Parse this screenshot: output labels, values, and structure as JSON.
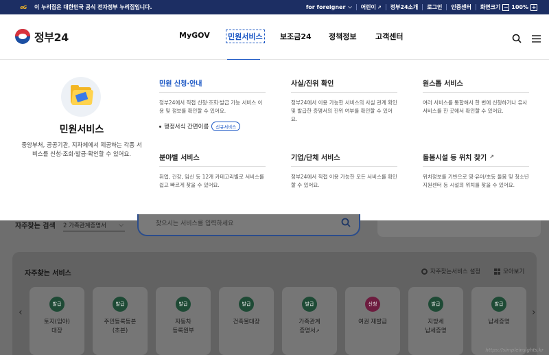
{
  "gov_bar": {
    "logo": "eG",
    "notice": "이 누리집은 대한민국 공식 전자정부 누리집입니다.",
    "links": [
      "for foreigner",
      "어린이",
      "정부24소개",
      "로그인",
      "인증센터",
      "화면크기"
    ],
    "zoom_minus": "−",
    "zoom_value": "100%",
    "zoom_plus": "+"
  },
  "header": {
    "logo_text": "정부24",
    "nav": [
      "MyGOV",
      "민원서비스",
      "보조금24",
      "정책정보",
      "고객센터"
    ]
  },
  "mega_menu": {
    "intro_title": "민원서비스",
    "intro_desc": "중앙부처, 공공기관, 지자체에서 제공하는 각종 서비스를 신청·조회·발급·확인할 수 있어요.",
    "sections": [
      {
        "title": "민원 신청·안내",
        "desc": "정부24에서 직접 신청·조회·발급 가능 서비스 이용 및 정보를 확인할 수 있어요.",
        "sub_item": "행정서식 간편이름",
        "sub_badge": "신규서비스"
      },
      {
        "title": "사실/진위 확인",
        "desc": "정부24에서 이용 가능한 서비스의 사실 관계 확인 및 발급한 증명서의 진위 여부를 확인할 수 있어요."
      },
      {
        "title": "원스톱 서비스",
        "desc": "여러 서비스를 통합해서 한 번에 신청하거나 유사 서비스를 한 곳에서 확인할 수 있어요."
      },
      {
        "title": "분야별 서비스",
        "desc": "취업, 건강, 임신 등 12개 카테고리별로 서비스를 쉽고 빠르게 찾을 수 있어요."
      },
      {
        "title": "기업/단체 서비스",
        "desc": "정부24에서 직접 이용 가능한 모든 서비스를 확인할 수 있어요."
      },
      {
        "title": "돌봄시설 등 위치 찾기",
        "desc": "위치정보를 기반으로 영·유아/초등 돌봄 및 청소년 지원센터 등 시설의 위치를 찾을 수 있어요."
      }
    ]
  },
  "search": {
    "label": "자주찾는 검색",
    "select_value": "2 가족관계증명서",
    "placeholder": "찾으시는 서비스를 입력하세요"
  },
  "frequent_services": {
    "title": "자주찾는 서비스",
    "setting_label": "자주찾는서비스 설정",
    "view_label": "모아보기",
    "cards": [
      {
        "badge": "발급",
        "label": "토지(임야)\n대장"
      },
      {
        "badge": "발급",
        "label": "주민등록등본\n(초본)"
      },
      {
        "badge": "발급",
        "label": "자동차\n등록원부"
      },
      {
        "badge": "발급",
        "label": "건축물대장"
      },
      {
        "badge": "발급",
        "label": "가족관계\n증명서"
      },
      {
        "badge": "신청",
        "label": "여권 재발급"
      },
      {
        "badge": "발급",
        "label": "지방세\n납세증명"
      },
      {
        "badge": "발급",
        "label": "납세증명"
      }
    ]
  },
  "watermark": "https://simpleinsights.kr"
}
